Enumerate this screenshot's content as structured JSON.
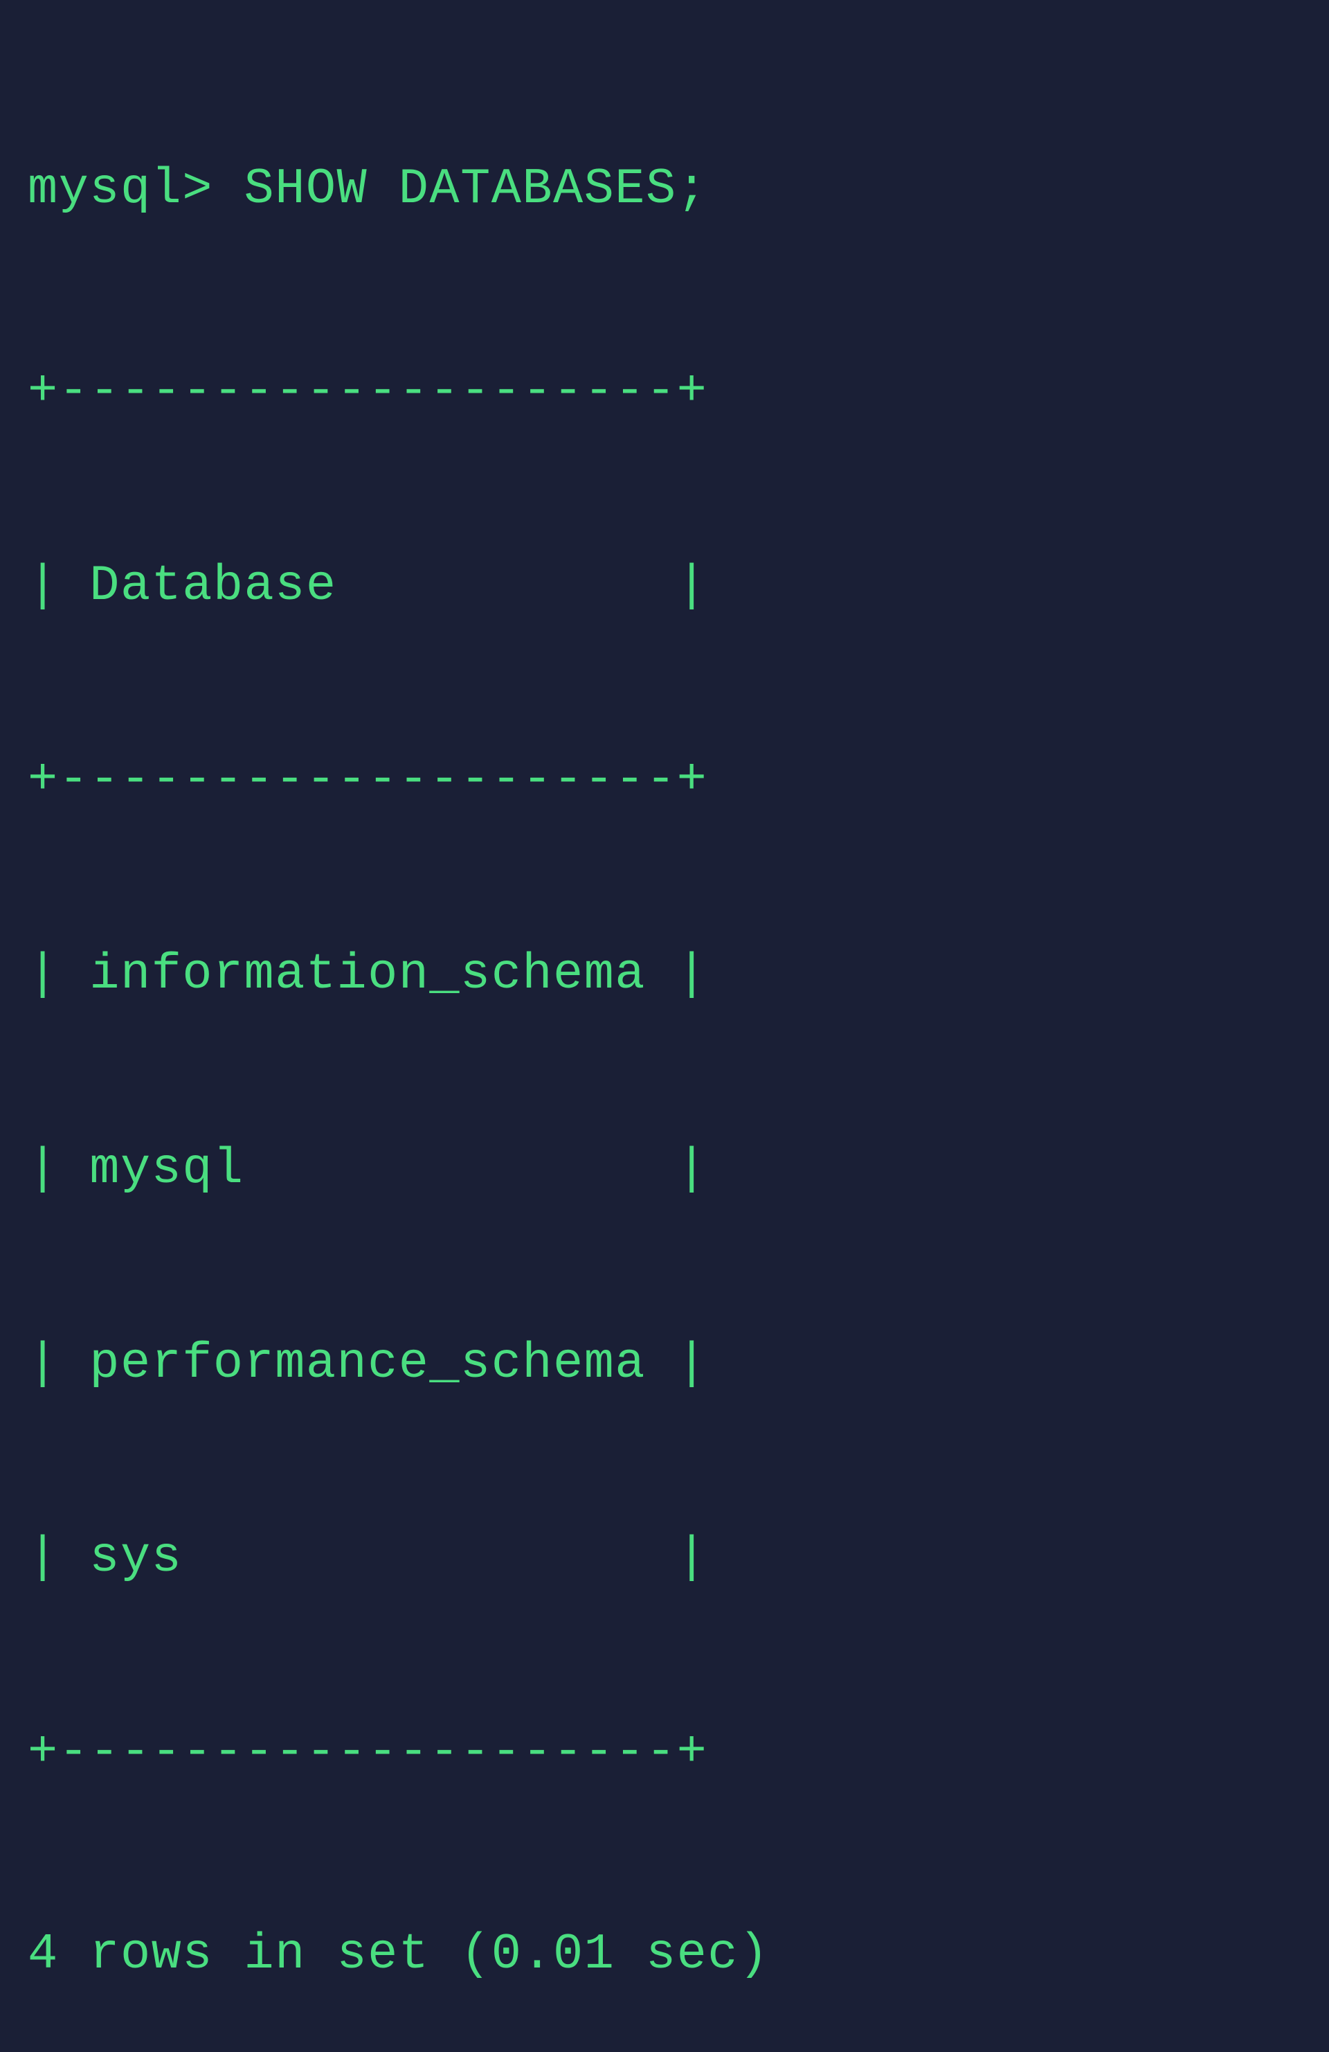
{
  "prompt": "mysql>",
  "command": "SHOW DATABASES;",
  "table": {
    "border_top": "+--------------------+",
    "header": "| Database           |",
    "border_mid": "+--------------------+",
    "rows": [
      "| information_schema |",
      "| mysql              |",
      "| performance_schema |",
      "| sys                |"
    ],
    "border_bottom": "+--------------------+",
    "column_header": "Database",
    "databases": [
      "information_schema",
      "mysql",
      "performance_schema",
      "sys"
    ]
  },
  "summary": "4 rows in set (0.01 sec)",
  "row_count": 4,
  "elapsed_sec": 0.01
}
